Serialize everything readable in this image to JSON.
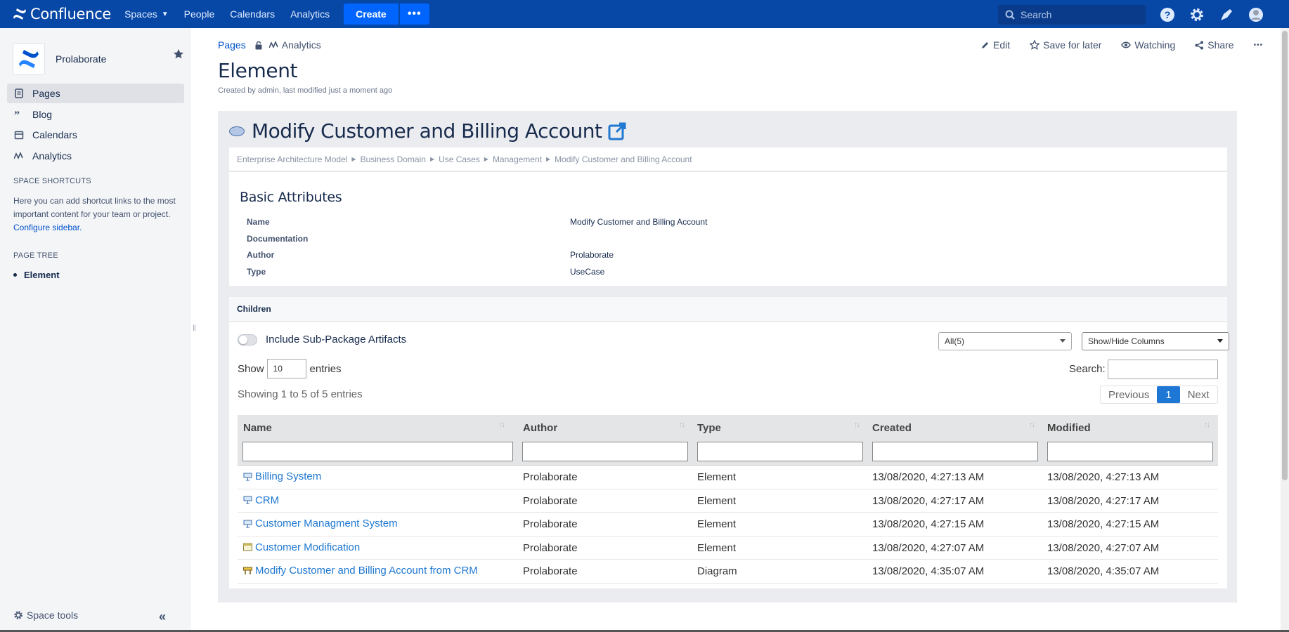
{
  "topnav": {
    "brand": "Confluence",
    "items": [
      {
        "label": "Spaces",
        "has_dropdown": true
      },
      {
        "label": "People"
      },
      {
        "label": "Calendars"
      },
      {
        "label": "Analytics"
      }
    ],
    "create_label": "Create",
    "more_label": "•••",
    "search_placeholder": "Search",
    "icons": [
      "help-icon",
      "settings-icon",
      "notifications-icon",
      "profile-avatar"
    ]
  },
  "sidebar": {
    "space_name": "Prolaborate",
    "items": [
      {
        "label": "Pages",
        "icon": "pages-icon",
        "active": true
      },
      {
        "label": "Blog",
        "icon": "blog-icon"
      },
      {
        "label": "Calendars",
        "icon": "calendar-icon"
      },
      {
        "label": "Analytics",
        "icon": "analytics-icon"
      }
    ],
    "shortcuts_title": "SPACE SHORTCUTS",
    "shortcuts_help": "Here you can add shortcut links to the most important content for your team or project.",
    "configure_link": "Configure sidebar.",
    "page_tree_title": "PAGE TREE",
    "page_tree_item": "Element",
    "space_tools": "Space tools",
    "collapse": "«"
  },
  "page": {
    "breadcrumb": {
      "pages": "Pages",
      "analytics": "Analytics"
    },
    "actions": {
      "edit": "Edit",
      "save": "Save for later",
      "watching": "Watching",
      "share": "Share",
      "more": "•••"
    },
    "title": "Element",
    "meta": "Created by admin, last modified just a moment ago"
  },
  "element": {
    "title": "Modify Customer and Billing Account",
    "path": [
      "Enterprise Architecture Model",
      "Business Domain",
      "Use Cases",
      "Management",
      "Modify Customer and Billing Account"
    ],
    "attributes_title": "Basic Attributes",
    "attributes": [
      {
        "label": "Name",
        "value": "Modify Customer and Billing Account"
      },
      {
        "label": "Documentation",
        "value": ""
      },
      {
        "label": "Author",
        "value": "Prolaborate"
      },
      {
        "label": "Type",
        "value": "UseCase"
      }
    ]
  },
  "children": {
    "title": "Children",
    "toggle_label": "Include Sub-Package Artifacts",
    "filter_select": "All(5)",
    "columns_select": "Show/Hide Columns",
    "show_label": "Show",
    "entries_value": "10",
    "entries_label": "entries",
    "search_label": "Search:",
    "showing": "Showing 1 to 5 of 5 entries",
    "pager": {
      "prev": "Previous",
      "current": "1",
      "next": "Next"
    },
    "columns": [
      "Name",
      "Author",
      "Type",
      "Created",
      "Modified"
    ],
    "rows": [
      {
        "name": "Billing System",
        "icon": "component-icon",
        "author": "Prolaborate",
        "type": "Element",
        "created": "13/08/2020, 4:27:13 AM",
        "modified": "13/08/2020, 4:27:13 AM"
      },
      {
        "name": "CRM",
        "icon": "component-icon",
        "author": "Prolaborate",
        "type": "Element",
        "created": "13/08/2020, 4:27:17 AM",
        "modified": "13/08/2020, 4:27:17 AM"
      },
      {
        "name": "Customer Managment System",
        "icon": "component-icon",
        "author": "Prolaborate",
        "type": "Element",
        "created": "13/08/2020, 4:27:15 AM",
        "modified": "13/08/2020, 4:27:15 AM"
      },
      {
        "name": "Customer Modification",
        "icon": "screen-icon",
        "author": "Prolaborate",
        "type": "Element",
        "created": "13/08/2020, 4:27:07 AM",
        "modified": "13/08/2020, 4:27:07 AM"
      },
      {
        "name": "Modify Customer and Billing Account from CRM",
        "icon": "diagram-icon",
        "author": "Prolaborate",
        "type": "Diagram",
        "created": "13/08/2020, 4:35:07 AM",
        "modified": "13/08/2020, 4:35:07 AM"
      }
    ]
  },
  "colors": {
    "topnav": "#0747a6",
    "create": "#0065ff",
    "link": "#1f78d1",
    "sidebar": "#f4f5f7"
  }
}
